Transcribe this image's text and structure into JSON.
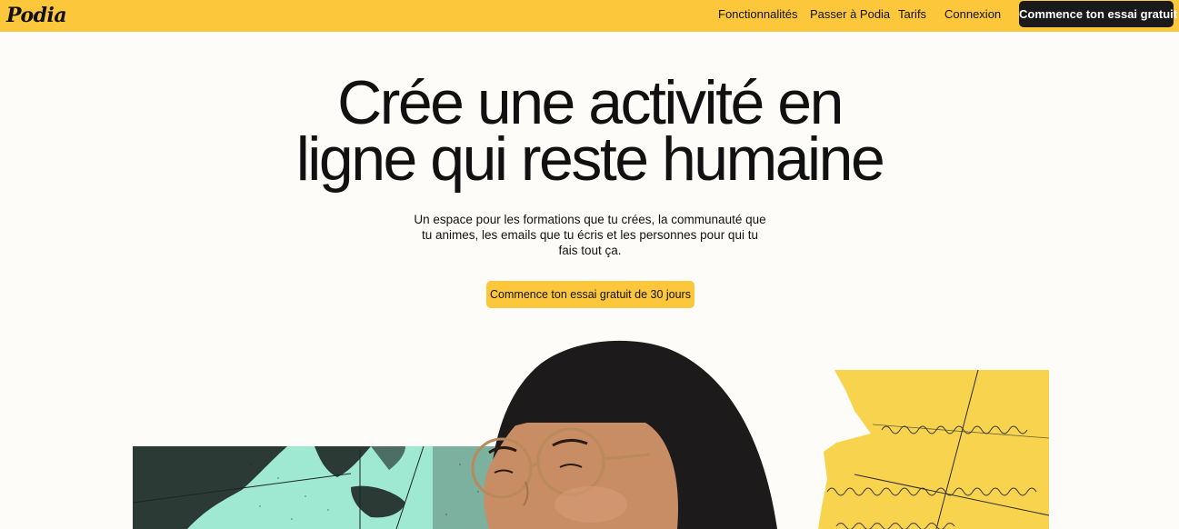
{
  "brand": {
    "logo_text": "Podia"
  },
  "nav": {
    "links": [
      {
        "label": "Fonctionnalités"
      },
      {
        "label": "Passer à Podia"
      },
      {
        "label": "Tarifs"
      },
      {
        "label": "Connexion"
      }
    ],
    "cta_label": "Commence ton essai gratuit"
  },
  "hero": {
    "title_line1": "Crée une activité en",
    "title_line2": "ligne qui reste humaine",
    "subtitle": "Un espace pour les formations que tu crées, la communauté que tu animes, les emails que tu écris et les personnes pour qui tu fais tout ça.",
    "cta_label": "Commence ton essai gratuit de 30 jours"
  },
  "colors": {
    "accent_yellow": "#fdc73c",
    "dark": "#1a1a1a",
    "mint": "#9fe8d2",
    "background": "#fdfcf9"
  },
  "icons": {
    "logo": "podia-wordmark",
    "portrait": "woman-with-glasses-photo",
    "collage_left": "mint-texture-collage",
    "collage_right": "yellow-handwritten-collage"
  }
}
